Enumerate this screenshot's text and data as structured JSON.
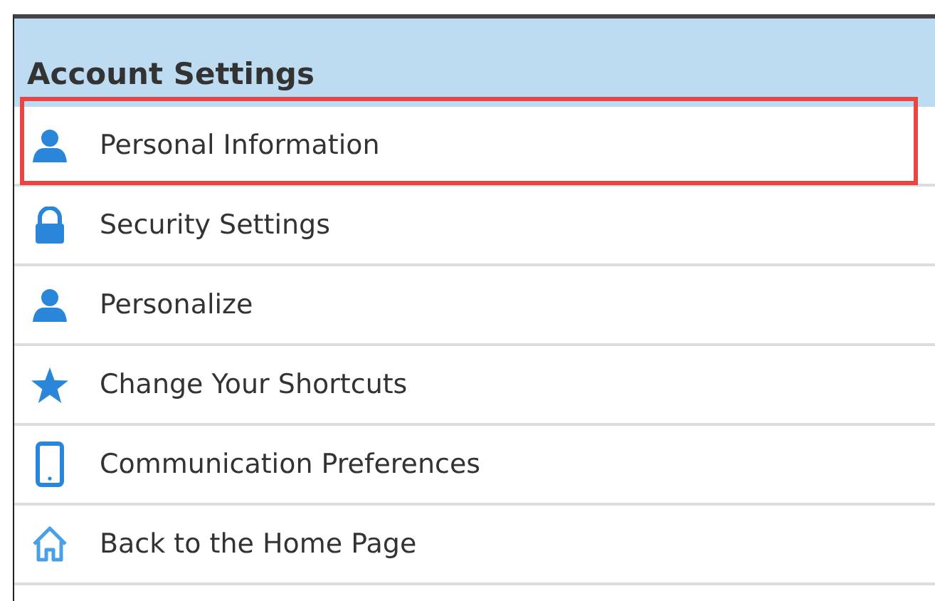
{
  "panel": {
    "title": "Account Settings"
  },
  "items": [
    {
      "label": "Personal Information",
      "highlighted": true
    },
    {
      "label": "Security Settings",
      "highlighted": false
    },
    {
      "label": "Personalize",
      "highlighted": false
    },
    {
      "label": "Change Your Shortcuts",
      "highlighted": false
    },
    {
      "label": "Communication Preferences",
      "highlighted": false
    },
    {
      "label": "Back to the Home Page",
      "highlighted": false
    }
  ]
}
